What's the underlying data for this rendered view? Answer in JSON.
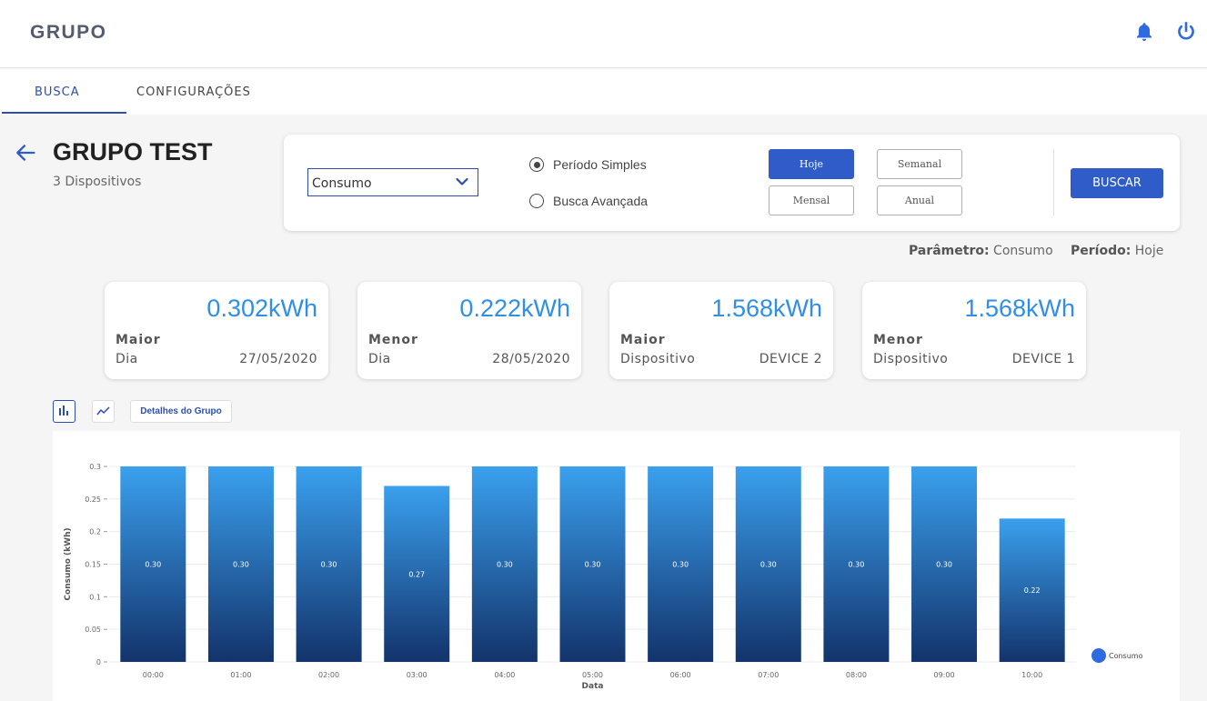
{
  "app": {
    "brand": "GRUPO"
  },
  "header": {
    "icons": [
      "bell-icon",
      "power-icon"
    ],
    "accent": "#2f6be0"
  },
  "tabs": [
    {
      "label": "BUSCA",
      "active": true
    },
    {
      "label": "CONFIGURAÇÕES",
      "active": false
    }
  ],
  "group": {
    "title": "GRUPO TEST",
    "subtitle": "3 Dispositivos"
  },
  "filter": {
    "select_value": "Consumo",
    "radios": [
      {
        "label": "Período Simples",
        "selected": true
      },
      {
        "label": "Busca Avançada",
        "selected": false
      }
    ],
    "periods": [
      {
        "label": "Hoje",
        "active": true
      },
      {
        "label": "Semanal",
        "active": false
      },
      {
        "label": "Mensal",
        "active": false
      },
      {
        "label": "Anual",
        "active": false
      }
    ],
    "search_label": "BUSCAR"
  },
  "summary": {
    "param_label": "Parâmetro:",
    "param_value": "Consumo",
    "period_label": "Período:",
    "period_value": "Hoje"
  },
  "stats": [
    {
      "value": "0.302kWh",
      "label": "Maior",
      "sub": "Dia",
      "detail": "27/05/2020"
    },
    {
      "value": "0.222kWh",
      "label": "Menor",
      "sub": "Dia",
      "detail": "28/05/2020"
    },
    {
      "value": "1.568kWh",
      "label": "Maior",
      "sub": "Dispositivo",
      "detail": "DEVICE 2"
    },
    {
      "value": "1.568kWh",
      "label": "Menor",
      "sub": "Dispositivo",
      "detail": "DEVICE 1"
    }
  ],
  "chart_controls": {
    "details_label": "Detalhes do Grupo"
  },
  "chart_data": {
    "type": "bar",
    "categories": [
      "00:00",
      "01:00",
      "02:00",
      "03:00",
      "04:00",
      "05:00",
      "06:00",
      "07:00",
      "08:00",
      "09:00",
      "10:00"
    ],
    "series": [
      {
        "name": "Consumo",
        "values": [
          0.3,
          0.3,
          0.3,
          0.27,
          0.3,
          0.3,
          0.3,
          0.3,
          0.3,
          0.3,
          0.22
        ]
      }
    ],
    "data_labels": [
      "0.30",
      "0.30",
      "0.30",
      "0.27",
      "0.30",
      "0.30",
      "0.30",
      "0.30",
      "0.30",
      "0.30",
      "0.22"
    ],
    "xlabel": "Data",
    "ylabel": "Consumo (kWh)",
    "ylim": [
      0,
      0.3
    ],
    "yticks": [
      {
        "value": 0,
        "label": "0"
      },
      {
        "value": 0.05,
        "label": "0.05"
      },
      {
        "value": 0.1,
        "label": "0.1"
      },
      {
        "value": 0.15,
        "label": "0.15"
      },
      {
        "value": 0.2,
        "label": "0.2"
      },
      {
        "value": 0.25,
        "label": "0.25"
      },
      {
        "value": 0.3,
        "label": "0.3"
      }
    ],
    "grid": true,
    "legend": "right",
    "colors": {
      "bar_top": "#3aa0ee",
      "bar_bottom": "#13336b"
    }
  }
}
